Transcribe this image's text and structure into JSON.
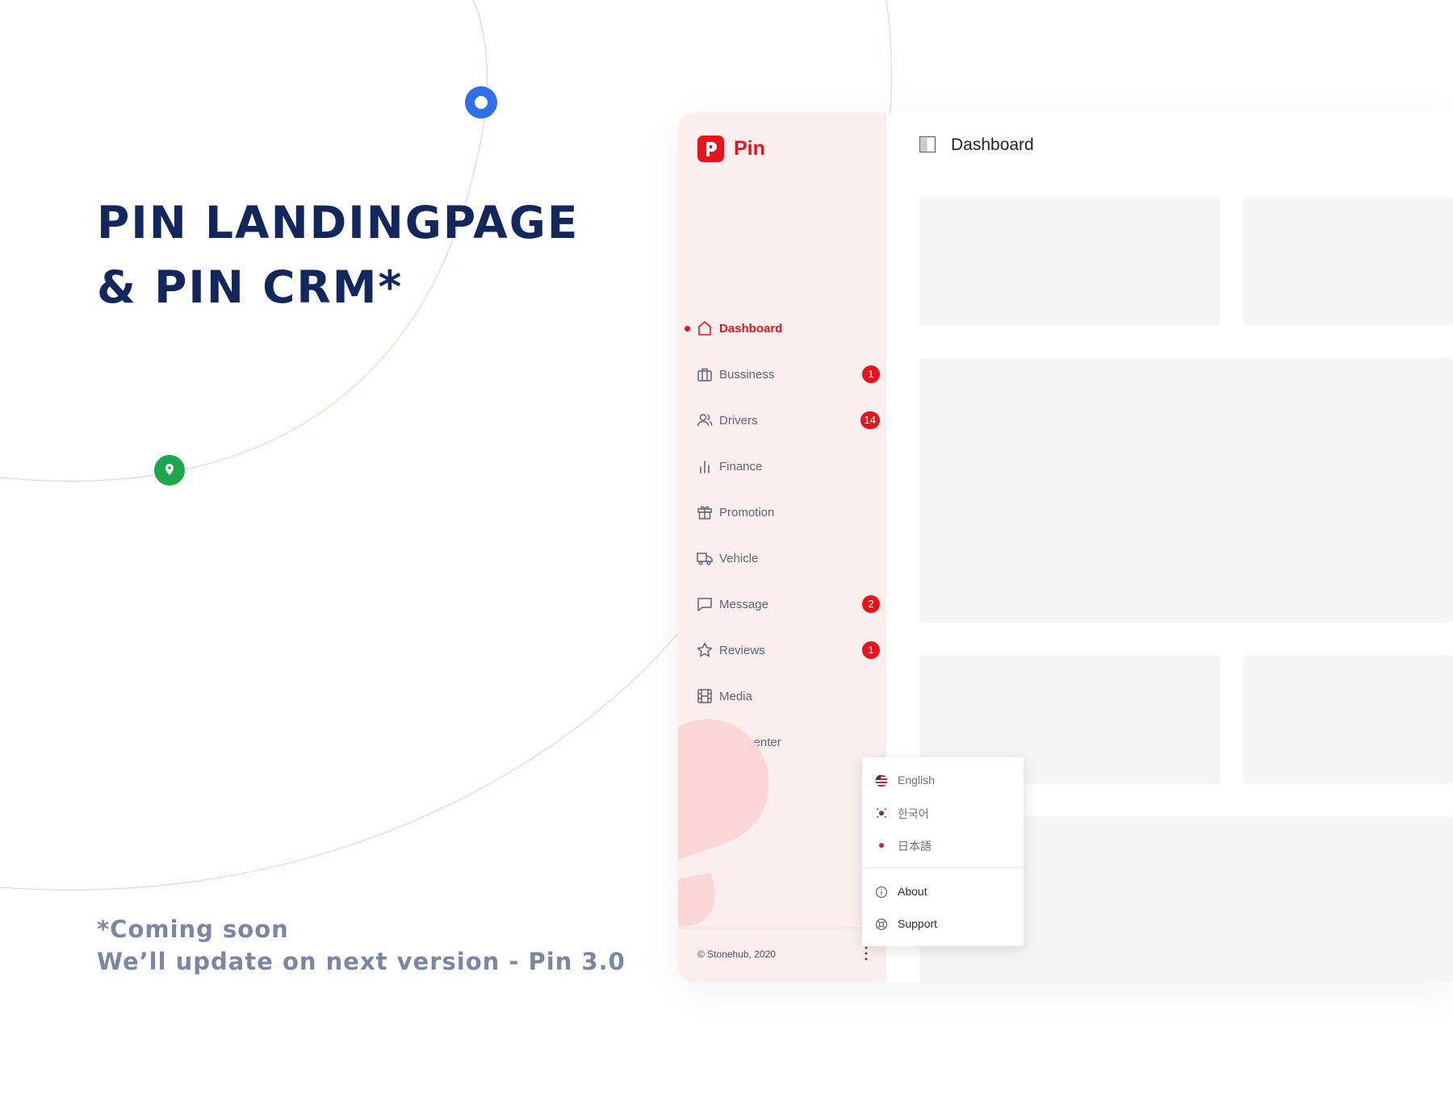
{
  "hero": {
    "title_line1": "PIN LANDINGPAGE",
    "title_line2": "& PIN CRM*",
    "note_line1": "*Coming soon",
    "note_line2": "We’ll update on next version - Pin 3.0"
  },
  "colors": {
    "brand": "#e8141b",
    "headline": "#12275e",
    "note": "#7a86a3",
    "sidebar_bg": "#fbeeee",
    "marker_blue": "#2f6fe8",
    "marker_green": "#1ea84e"
  },
  "sidebar": {
    "brand_name": "Pin",
    "items": [
      {
        "label": "Dashboard",
        "icon": "home-icon",
        "active": true
      },
      {
        "label": "Bussiness",
        "icon": "briefcase-icon",
        "badge": "1"
      },
      {
        "label": "Drivers",
        "icon": "users-icon",
        "badge": "14"
      },
      {
        "label": "Finance",
        "icon": "bar-chart-icon"
      },
      {
        "label": "Promotion",
        "icon": "gift-icon"
      },
      {
        "label": "Vehicle",
        "icon": "truck-icon"
      },
      {
        "label": "Message",
        "icon": "message-icon",
        "badge": "2"
      },
      {
        "label": "Reviews",
        "icon": "star-icon",
        "badge": "1"
      },
      {
        "label": "Media",
        "icon": "film-icon"
      },
      {
        "label": "Help center",
        "icon": "help-circle-icon"
      }
    ],
    "copyright": "© Stonehub, 2020"
  },
  "main": {
    "title": "Dashboard"
  },
  "menu": {
    "languages": [
      {
        "label": "English",
        "icon": "us-flag-icon"
      },
      {
        "label": "한국어",
        "icon": "korea-flag-icon"
      },
      {
        "label": "日本語",
        "icon": "japan-flag-icon"
      }
    ],
    "about": "About",
    "support": "Support"
  }
}
